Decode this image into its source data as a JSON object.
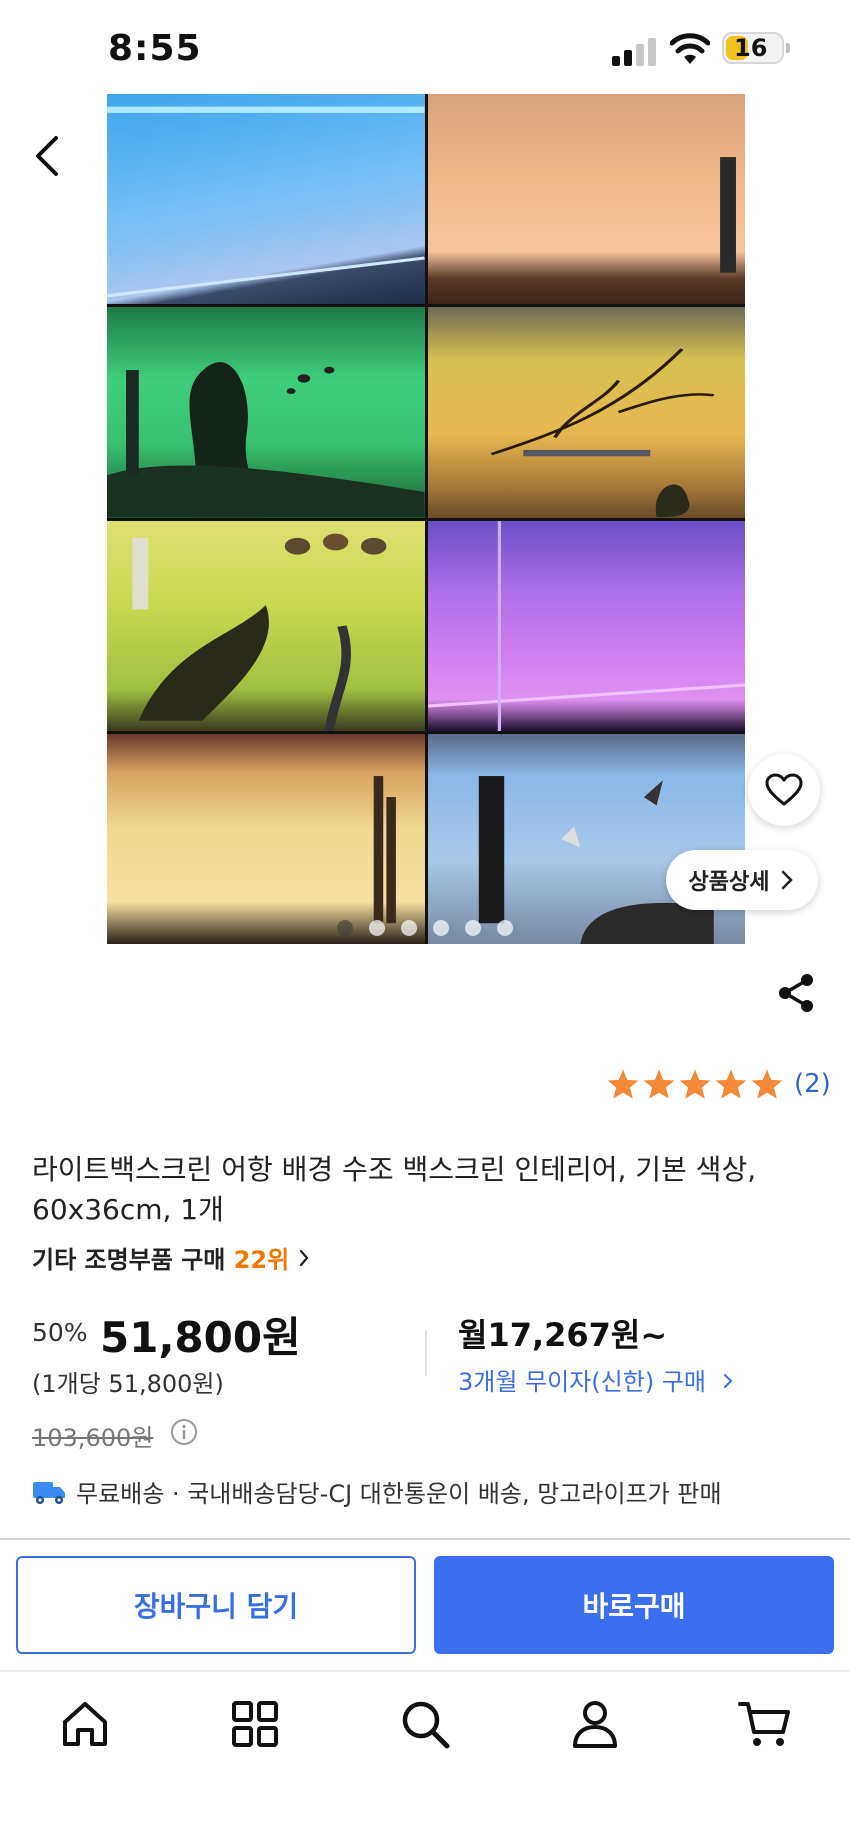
{
  "status_bar": {
    "time": "8:55",
    "battery": "16"
  },
  "product": {
    "detail_button": "상품상세",
    "review_count": "(2)",
    "rating": 5,
    "title": "라이트백스크린 어항 배경 수조 백스크린 인테리어, 기본 색상, 60x36cm, 1개",
    "rank_label": "기타 조명부품 구매",
    "rank_value": "22위",
    "discount": "50%",
    "price": "51,800원",
    "unit_price": "(1개당 51,800원)",
    "monthly": "월17,267원~",
    "installment": "3개월 무이자(신한) 구매",
    "original_price": "103,600원",
    "delivery": "무료배송 · 국내배송담당-CJ 대한통운이 배송, 망고라이프가 판매"
  },
  "gallery": {
    "slide_count": 6,
    "active_index": 0
  },
  "actions": {
    "cart": "장바구니 담기",
    "buy": "바로구매"
  },
  "colors": {
    "accent": "#3b6ff0",
    "rank": "#f07800",
    "star": "#f5893a",
    "link": "#3a6fe0"
  },
  "bottom_nav": [
    "home-icon",
    "grid-icon",
    "search-icon",
    "person-icon",
    "cart-icon"
  ]
}
